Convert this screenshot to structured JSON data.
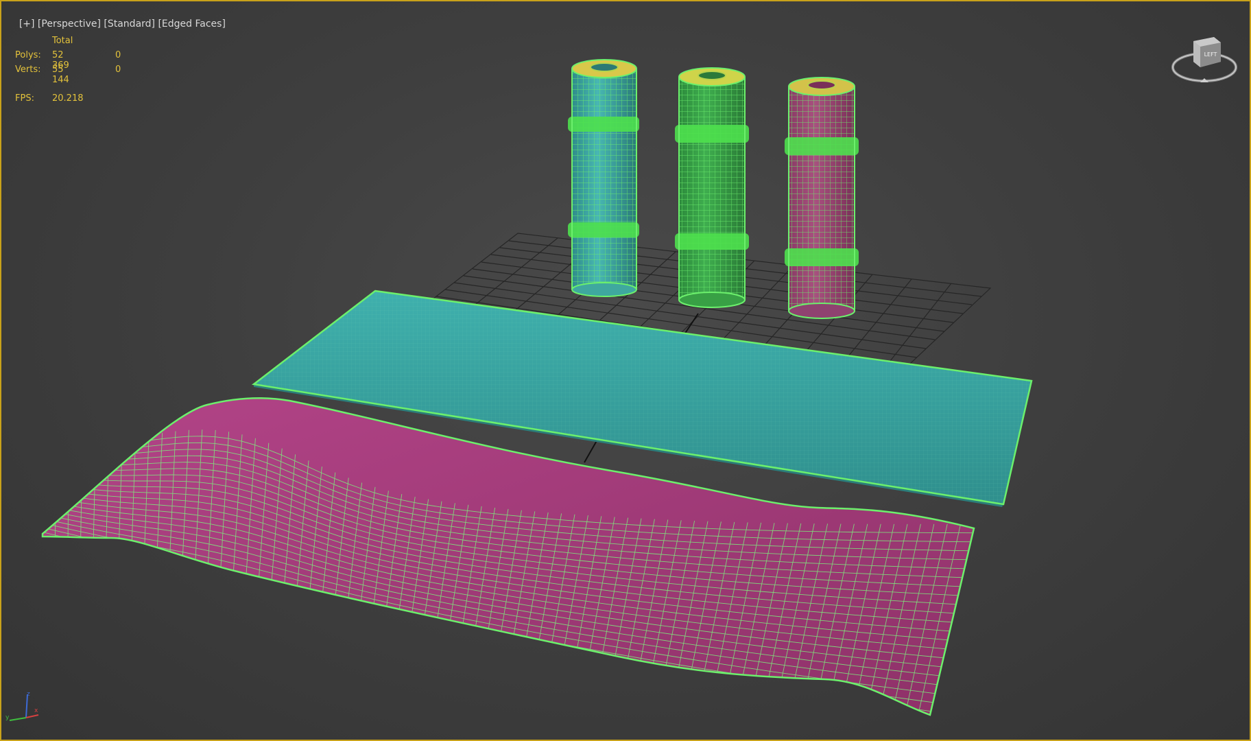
{
  "viewport": {
    "labels": {
      "plus": "[+]",
      "view": "[Perspective]",
      "shading": "[Standard]",
      "edges": "[Edged Faces]"
    },
    "stats": {
      "header": "Total",
      "polys_label": "Polys:",
      "polys_total": "52 369",
      "polys_selected": "0",
      "verts_label": "Verts:",
      "verts_total": "55 144",
      "verts_selected": "0",
      "fps_label": "FPS:",
      "fps_value": "20.218"
    },
    "viewcube": {
      "face_label": "LEFT"
    },
    "axis_tripod": {
      "z": "z",
      "x": "x",
      "y": "y"
    }
  },
  "colors": {
    "selection_wire": "#5fe85f",
    "teal_mat": "#3aa4a2",
    "pink_mat": "#a33c79",
    "stat_text": "#e3c23b",
    "active_border": "#c9a21a"
  }
}
